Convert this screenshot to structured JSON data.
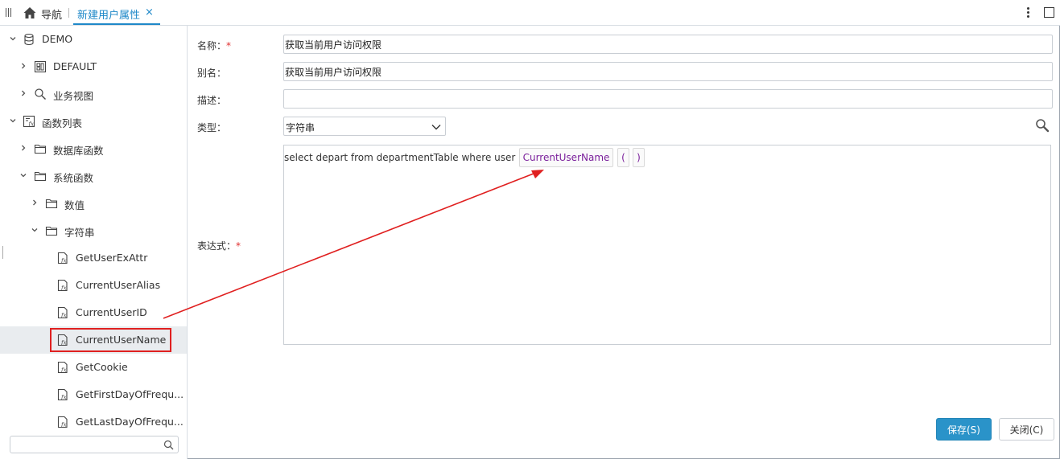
{
  "topbar": {
    "nav_label": "导航",
    "tab_label": "新建用户属性",
    "tab_close": "×"
  },
  "tree": {
    "items": [
      {
        "label": "DEMO",
        "icon": "database-icon",
        "expanded": true
      },
      {
        "label": "DEFAULT",
        "icon": "schema-icon",
        "expanded": false
      },
      {
        "label": "业务视图",
        "icon": "search-view-icon",
        "expanded": false
      },
      {
        "label": "函数列表",
        "icon": "function-list-icon",
        "expanded": true
      },
      {
        "label": "数据库函数",
        "icon": "folder-icon",
        "expanded": false
      },
      {
        "label": "系统函数",
        "icon": "folder-icon",
        "expanded": true
      },
      {
        "label": "数值",
        "icon": "folder-icon",
        "expanded": false
      },
      {
        "label": "字符串",
        "icon": "folder-icon",
        "expanded": true
      },
      {
        "label": "GetUserExAttr",
        "icon": "function-icon"
      },
      {
        "label": "CurrentUserAlias",
        "icon": "function-icon"
      },
      {
        "label": "CurrentUserID",
        "icon": "function-icon"
      },
      {
        "label": "CurrentUserName",
        "icon": "function-icon",
        "selected": true
      },
      {
        "label": "GetCookie",
        "icon": "function-icon"
      },
      {
        "label": "GetFirstDayOfFrequ...",
        "icon": "function-icon"
      },
      {
        "label": "GetLastDayOfFrequ...",
        "icon": "function-icon"
      }
    ],
    "search_value": ""
  },
  "form": {
    "name_label": "名称：",
    "name_value": "获取当前用户访问权限",
    "alias_label": "别名：",
    "alias_value": "获取当前用户访问权限",
    "desc_label": "描述：",
    "desc_value": "",
    "type_label": "类型：",
    "type_value": "字符串",
    "expr_label": "表达式：",
    "required_mark": "*",
    "expr_text": "select depart from departmentTable where user =",
    "expr_token": "CurrentUserName",
    "expr_paren_open": "(",
    "expr_paren_close": ")"
  },
  "buttons": {
    "save": "保存(S)",
    "close": "关闭(C)"
  },
  "colors": {
    "accent": "#1e88c8",
    "primary_button": "#2a93c9",
    "highlight": "#e02020",
    "token_text": "#7a1f9b"
  }
}
